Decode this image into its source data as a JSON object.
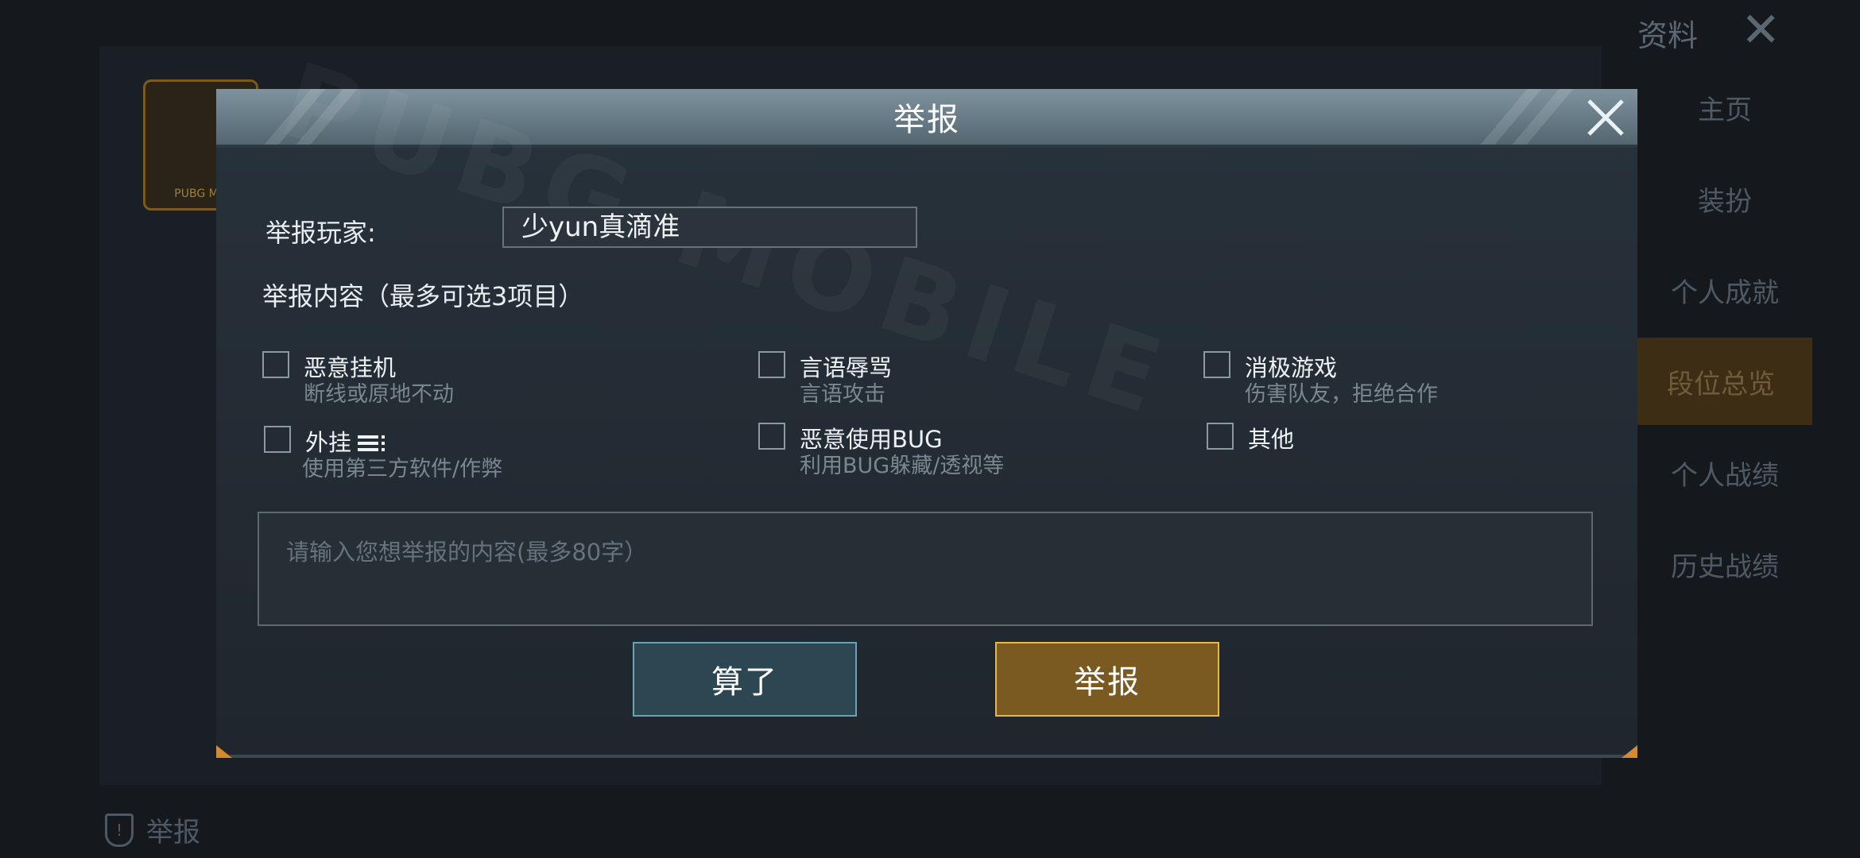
{
  "background": {
    "logo_text": "PUBG MO",
    "report_link": "举报",
    "sidebar": {
      "title": "资料",
      "items": [
        "主页",
        "装扮",
        "个人成就",
        "段位总览",
        "个人战绩",
        "历史战绩"
      ],
      "active_index": 3
    }
  },
  "dialog": {
    "title": "举报",
    "watermark": "PUBG MOBILE",
    "player_label": "举报玩家:",
    "player_name": "少yun真滴准",
    "content_label": "举报内容（最多可选3项目）",
    "options": [
      {
        "title": "恶意挂机",
        "subtitle": "断线或原地不动",
        "checked": false
      },
      {
        "title": "言语辱骂",
        "subtitle": "言语攻击",
        "checked": false
      },
      {
        "title": "消极游戏",
        "subtitle": "伤害队友，拒绝合作",
        "checked": false
      },
      {
        "title": "外挂",
        "subtitle": "使用第三方软件/作弊",
        "checked": false,
        "icon": "list-icon"
      },
      {
        "title": "恶意使用BUG",
        "subtitle": "利用BUG躲藏/透视等",
        "checked": false
      },
      {
        "title": "其他",
        "subtitle": "",
        "checked": false
      }
    ],
    "reason_placeholder": "请输入您想举报的内容(最多80字）",
    "cancel_label": "算了",
    "submit_label": "举报"
  },
  "colors": {
    "submit_bg": "#7b5a22",
    "submit_border": "#e6b84d",
    "cancel_bg": "#2c4652",
    "cancel_border": "#6aa2b4",
    "header": "#6e828e"
  }
}
